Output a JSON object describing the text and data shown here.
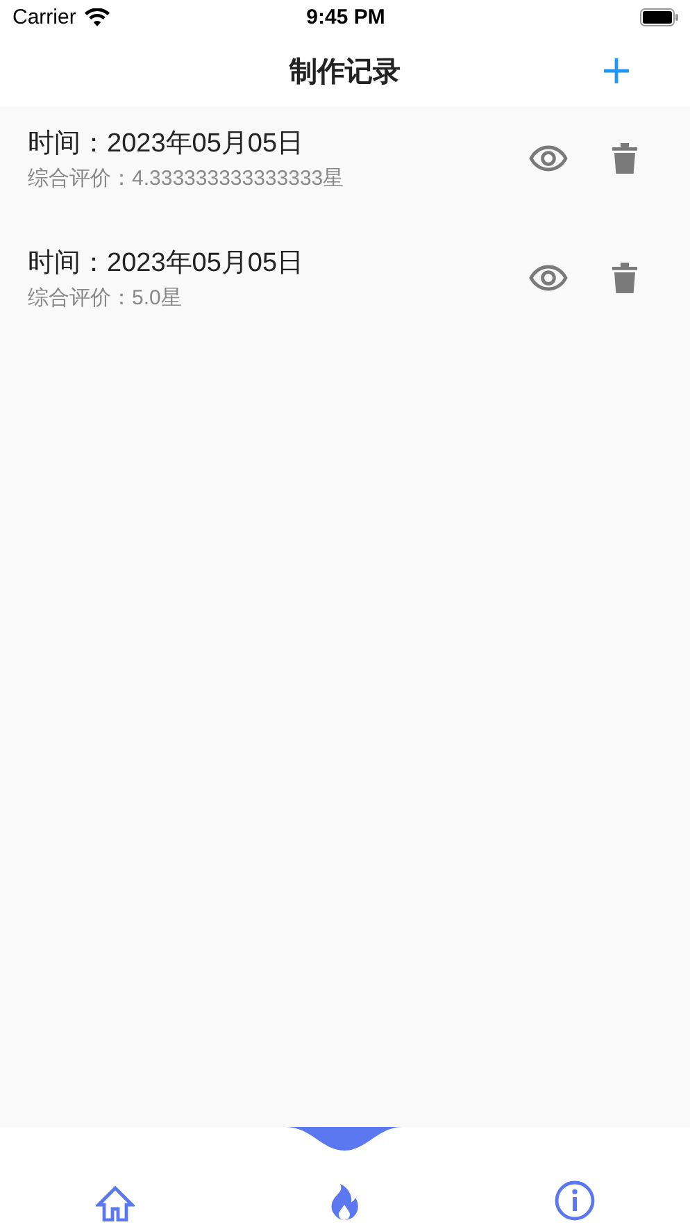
{
  "status_bar": {
    "carrier": "Carrier",
    "time": "9:45 PM"
  },
  "nav": {
    "title": "制作记录"
  },
  "records": [
    {
      "time": "时间：2023年05月05日",
      "rating": "综合评价：4.333333333333333星"
    },
    {
      "time": "时间：2023年05月05日",
      "rating": "综合评价：5.0星"
    }
  ],
  "tabs": [
    {
      "kind": "home",
      "selected": false
    },
    {
      "kind": "flame",
      "selected": true
    },
    {
      "kind": "info",
      "selected": false
    }
  ]
}
